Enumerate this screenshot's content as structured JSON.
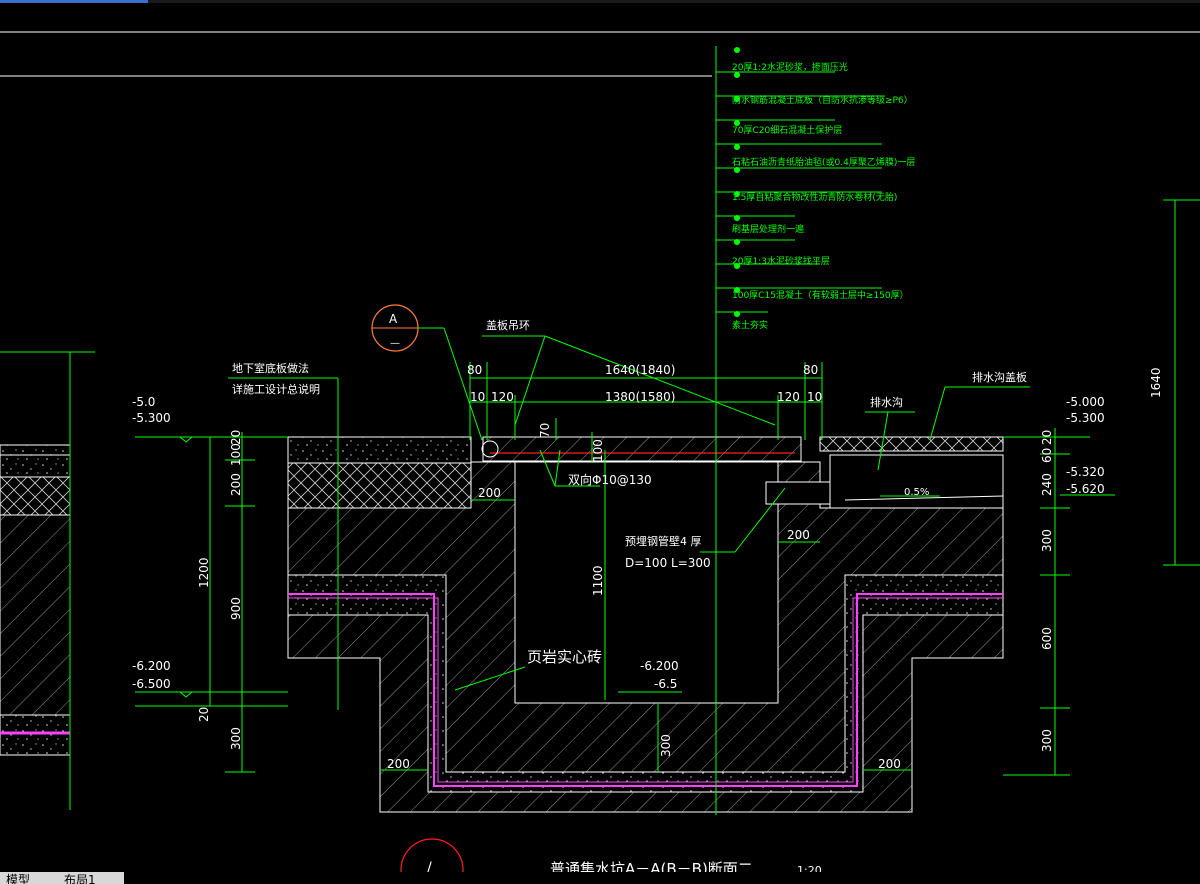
{
  "section_marker": {
    "letter": "A",
    "sheet": "—"
  },
  "section_marker2": {
    "symbol": "/"
  },
  "callouts": {
    "floor_method": "地下室底板做法",
    "floor_method_2": "详施工设计总说明",
    "cover_ring": "盖板吊环",
    "drain_ditch": "排水沟",
    "ditch_cover": "排水沟盖板",
    "rebar": "双向Φ10@130",
    "pipe": "预埋钢管壁4 厚",
    "pipe_size": "D=100   L=300",
    "brick": "页岩实心砖"
  },
  "layers": [
    "20厚1:2水泥砂浆，掺面压光",
    "防水钢筋混凝土底板（自防水抗渗等级≥P6）",
    "70厚C20细石混凝土保护层",
    "石粘石油沥青纸胎油毡(或0.4厚聚乙烯膜)一层",
    "1.5厚自粘聚合物改性沥青防水卷材(无胎)",
    "刷基层处理剂一遍",
    "20厚1:3水泥砂浆找平层",
    "100厚C15混凝土（有软弱土层中≥150厚）",
    "素土夯实"
  ],
  "dims": {
    "top_total": "1640(1840)",
    "top_inner": "1380(1580)",
    "d80a": "80",
    "d80b": "80",
    "d10a": "10",
    "d120a": "120",
    "d120b": "120",
    "d10b": "10",
    "d70": "70",
    "d100v": "100",
    "d1100": "1100",
    "d200_left": "200",
    "d200_right": "200",
    "d200_bl": "200",
    "d200_br": "200",
    "d300_mid": "300",
    "slope": "0.5%",
    "right_total": "1640",
    "left_20": "20",
    "left_100": "100",
    "left_200": "200",
    "left_1200": "1200",
    "left_900": "900",
    "left_20b": "20",
    "left_300": "300",
    "right_20": "20",
    "right_60": "60",
    "right_240": "240",
    "right_300": "300",
    "right_600": "600",
    "right_300b": "300"
  },
  "elevations": {
    "left_top1": "-5.0",
    "left_top2": "-5.300",
    "left_bot1": "-6.200",
    "left_bot2": "-6.500",
    "mid_bot1": "-6.200",
    "mid_bot2": "-6.5",
    "right_top1": "-5.000",
    "right_top2": "-5.300",
    "right_mid1": "-5.320",
    "right_mid2": "-5.620"
  },
  "title": {
    "text": "普通集水坑A－A(B－B)断面二",
    "scale": "1:20"
  },
  "tabs": [
    "模型",
    "布局1"
  ],
  "colors": {
    "leader": "#00ff00",
    "wall": "#ffffff",
    "membrane": "#ff40ff",
    "marker": "#ff8040",
    "rebar": "#ff2020"
  }
}
